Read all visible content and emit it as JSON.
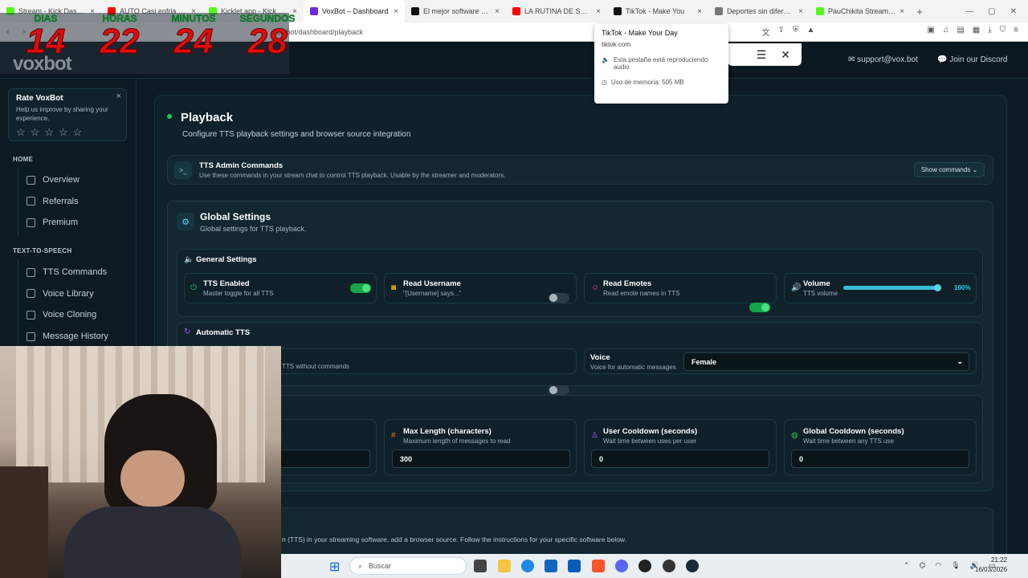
{
  "browser": {
    "tabs": [
      {
        "title": "Stream - Kick Dashbo",
        "color": "#53fc18",
        "active": false
      },
      {
        "title": "AUTO Casi enfria a Fi",
        "color": "#ff0000",
        "active": false
      },
      {
        "title": "Kicklet.app - Kick Chatbot",
        "color": "#53fc18",
        "active": false
      },
      {
        "title": "VoxBot – Dashboard",
        "color": "#6d28d9",
        "active": true
      },
      {
        "title": "El mejor software para pod",
        "color": "#111111",
        "active": false
      },
      {
        "title": "LA RUTINA DE SAITAMA",
        "color": "#ff0000",
        "active": false
      },
      {
        "title": "TikTok - Make You",
        "color": "#111111",
        "active": false
      },
      {
        "title": "Deportes sin diferencia fis",
        "color": "#777777",
        "active": false
      },
      {
        "title": "PauChikita Stream - W",
        "color": "#53fc18",
        "active": false
      }
    ],
    "url": "vox.bot/dashboard/playback",
    "tab_popup": {
      "title": "TikTok - Make Your Day",
      "domain": "tiktok.com",
      "audio": "Esta pestaña está reproduciendo audio",
      "memory": "Uso de memoria: 505 MB"
    }
  },
  "timer": {
    "labels": [
      "DIAS",
      "HORAS",
      "MINUTOS",
      "SEGUNDOS"
    ],
    "values": [
      "14",
      "22",
      "24",
      "28"
    ]
  },
  "header": {
    "logo": "voxbot",
    "support_email": "support@vox.bot",
    "discord": "Join our Discord"
  },
  "sidebar": {
    "rate": {
      "title": "Rate VoxBot",
      "subtitle": "Help us improve by sharing your experience.",
      "stars": "☆☆☆☆☆",
      "close": "×"
    },
    "home_title": "HOME",
    "home_items": [
      "Overview",
      "Referrals",
      "Premium"
    ],
    "tts_title": "TEXT-TO-SPEECH",
    "tts_items": [
      "TTS Commands",
      "Voice Library",
      "Voice Cloning",
      "Message History"
    ]
  },
  "page": {
    "title": "Playback",
    "subtitle": "Configure TTS playback settings and browser source integration",
    "admin": {
      "title": "TTS Admin Commands",
      "subtitle": "Use these commands in your stream chat to control TTS playback. Usable by the streamer and moderators.",
      "button": "Show commands"
    },
    "global": {
      "title": "Global Settings",
      "subtitle": "Global settings for TTS playback."
    },
    "general": {
      "title": "General Settings",
      "tts_enabled": {
        "label": "TTS Enabled",
        "desc": "Master toggle for all TTS",
        "on": true
      },
      "read_username": {
        "label": "Read Username",
        "desc": "\"[Username] says...\"",
        "on": false
      },
      "read_emotes": {
        "label": "Read Emotes",
        "desc": "Read emote names in TTS",
        "on": true
      },
      "volume": {
        "label": "Volume",
        "desc": "TTS volume",
        "value": 100,
        "display": "100%"
      }
    },
    "automatic": {
      "title": "Automatic TTS",
      "auto_desc": "TTS without commands",
      "auto_on": false,
      "voice_label": "Voice",
      "voice_desc": "Voice for automatic messages",
      "voice_value": "Female"
    },
    "limits": {
      "max_length": {
        "label": "Max Length (characters)",
        "desc": "Maximum length of messages to read",
        "value": "300"
      },
      "user_cooldown": {
        "label": "User Cooldown (seconds)",
        "desc": "Wait time between uses per user",
        "value": "0"
      },
      "global_cooldown": {
        "label": "Global Cooldown (seconds)",
        "desc": "Wait time between any TTS use",
        "value": "0"
      }
    },
    "browser_source_text": "n (TTS) in your streaming software, add a browser source. Follow the instructions for your specific software below."
  },
  "taskbar": {
    "search": "Buscar",
    "time": "21:22",
    "date": "16/03/2026"
  },
  "colors": {
    "accent_green": "#22c55e",
    "slider": "#38bdd8",
    "percent": "#22d3ee"
  }
}
